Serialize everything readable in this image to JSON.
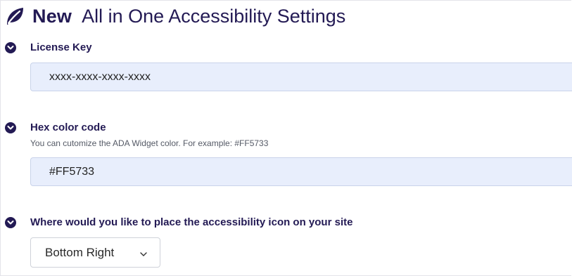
{
  "header": {
    "brand": "New",
    "title": "All in One Accessibility Settings"
  },
  "license": {
    "label": "License Key",
    "value": "xxxx-xxxx-xxxx-xxxx"
  },
  "hex_color": {
    "label": "Hex color code",
    "help": "You can cutomize the ADA Widget color. For example: #FF5733",
    "value": "#FF5733"
  },
  "position": {
    "label": "Where would you like to place the accessibility icon on your site",
    "selected": "Bottom Right"
  },
  "colors": {
    "accent": "#231a54",
    "input_bg": "#e8eefc"
  },
  "icons": {
    "logo": "leaf-icon",
    "section_toggle": "chevron-down-circle-icon",
    "dropdown": "chevron-down-icon"
  }
}
